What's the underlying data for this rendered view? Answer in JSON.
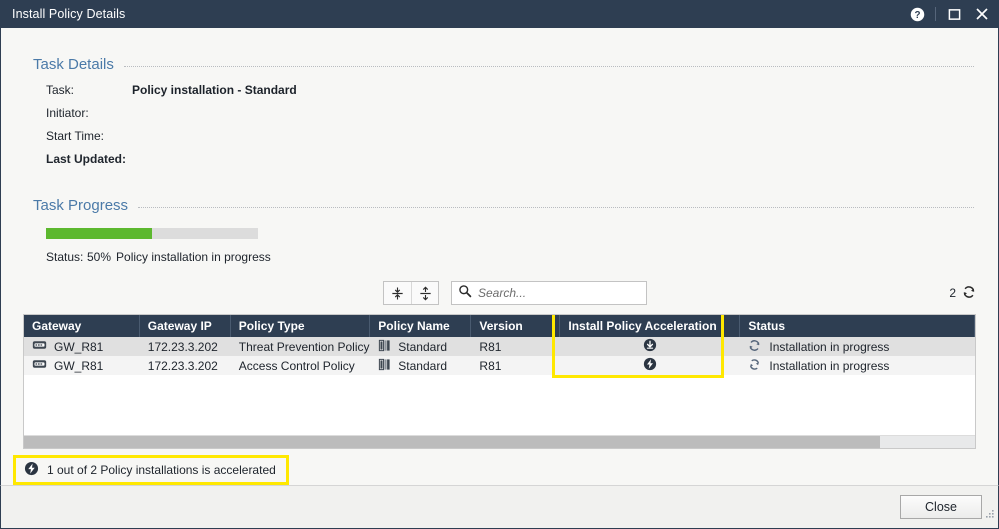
{
  "window": {
    "title": "Install Policy Details",
    "buttons": {
      "help": "?",
      "maximize": "Maximize",
      "close": "Close"
    }
  },
  "task_details": {
    "section_title": "Task Details",
    "rows": [
      {
        "label": "Task:",
        "value": "Policy installation - Standard"
      },
      {
        "label": "Initiator:",
        "value": ""
      },
      {
        "label": "Start Time:",
        "value": ""
      },
      {
        "label": "Last Updated:",
        "value": ""
      }
    ]
  },
  "task_progress": {
    "section_title": "Task Progress",
    "percent": 50,
    "percent_label": "50%",
    "status_label": "Status:",
    "status_text": "Policy installation in progress",
    "bar_color": "#5cb82e",
    "track_color": "#dcdcdc"
  },
  "toolbar": {
    "expand_all_icon": "expand-all-icon",
    "collapse_all_icon": "collapse-all-icon",
    "search_placeholder": "Search...",
    "search_value": "",
    "result_count": "2",
    "refresh_icon": "refresh-icon"
  },
  "table": {
    "columns": [
      "Gateway",
      "Gateway IP",
      "Policy Type",
      "Policy Name",
      "Version",
      "Install Policy Acceleration",
      "Status"
    ],
    "highlighted_column": "Install Policy Acceleration",
    "rows": [
      {
        "gateway": "GW_R81",
        "gateway_icon": "gateway-icon",
        "gateway_ip": "172.23.3.202",
        "policy_type": "Threat Prevention Policy",
        "policy_name": "Standard",
        "policy_name_icon": "policy-package-icon",
        "version": "R81",
        "acceleration_icon": "download-arrow-icon",
        "status": "Installation in progress",
        "status_icon": "in-progress-icon"
      },
      {
        "gateway": "GW_R81",
        "gateway_icon": "gateway-icon",
        "gateway_ip": "172.23.3.202",
        "policy_type": "Access Control Policy",
        "policy_name": "Standard",
        "policy_name_icon": "policy-package-icon",
        "version": "R81",
        "acceleration_icon": "lightning-bolt-icon",
        "status": "Installation in progress",
        "status_icon": "in-progress-icon"
      }
    ]
  },
  "footer_note": {
    "icon": "lightning-bolt-icon",
    "text": "1 out of 2 Policy installations is accelerated"
  },
  "bottom_bar": {
    "close_label": "Close"
  },
  "colors": {
    "titlebar": "#2e3e52",
    "accent_heading": "#4b7aa8",
    "progress_green": "#5cb82e",
    "highlight_yellow": "#ffe800"
  }
}
